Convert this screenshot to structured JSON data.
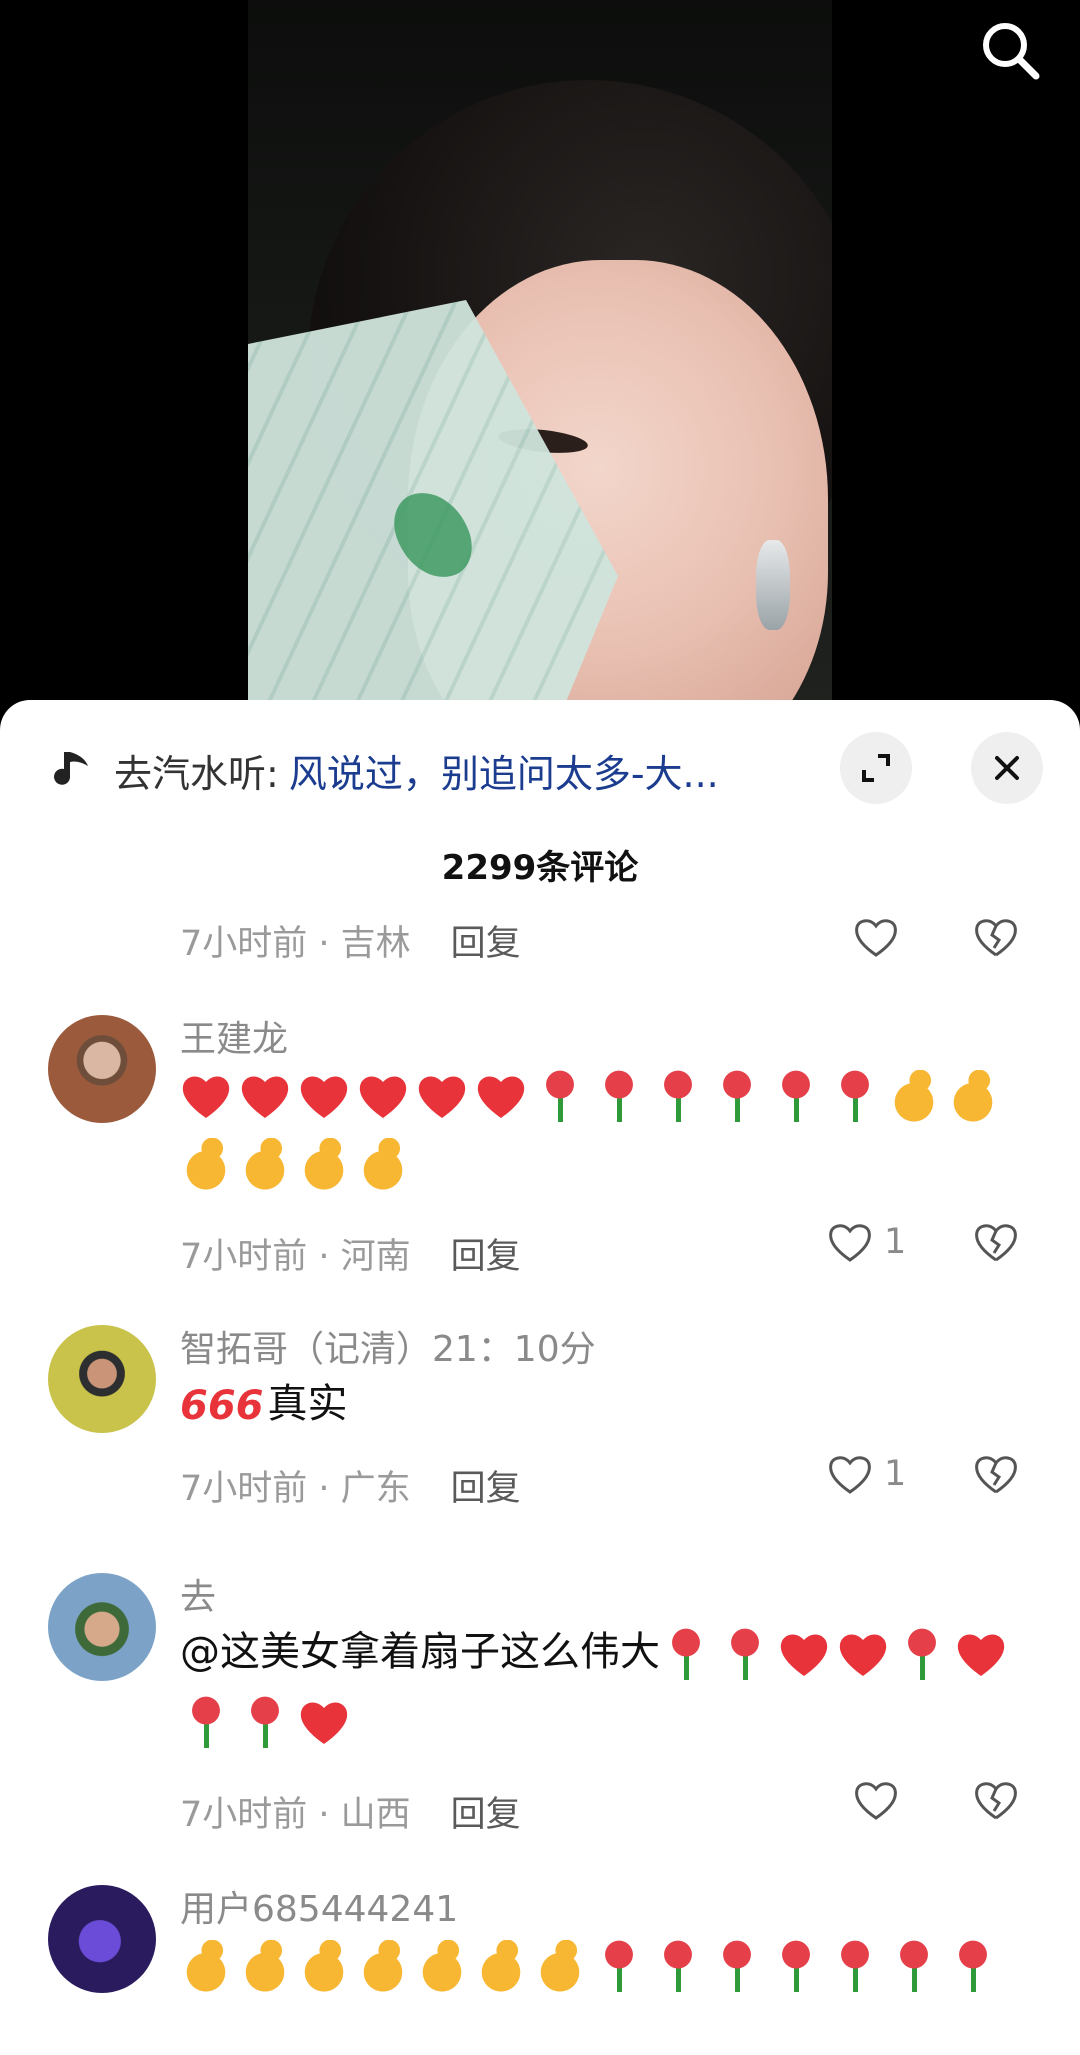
{
  "music": {
    "prefix": "去汽水听: ",
    "title": "风说过，别追问太多-大..."
  },
  "comment_count": "2299条评论",
  "partial_meta": {
    "time_loc": "7小时前 · 吉林",
    "reply": "回复"
  },
  "comments": [
    {
      "user": "王建龙",
      "emojis": [
        "heart",
        "heart",
        "heart",
        "heart",
        "heart",
        "heart",
        "rose",
        "rose",
        "rose",
        "rose",
        "rose",
        "rose",
        "thumb",
        "thumb",
        "thumb",
        "thumb",
        "thumb",
        "thumb"
      ],
      "time_loc": "7小时前 · 河南",
      "reply": "回复",
      "likes": "1"
    },
    {
      "user": "智拓哥（记清）21：10分",
      "prefix_glyph": "666",
      "text": "真实",
      "time_loc": "7小时前 · 广东",
      "reply": "回复",
      "likes": "1"
    },
    {
      "user": "去",
      "text": "@这美女拿着扇子这么伟大",
      "emojis": [
        "rose",
        "rose",
        "heart",
        "heart",
        "rose",
        "heart",
        "rose",
        "rose",
        "heart"
      ],
      "time_loc": "7小时前 · 山西",
      "reply": "回复"
    },
    {
      "user": "用户685444241",
      "emojis": [
        "thumb",
        "thumb",
        "thumb",
        "thumb",
        "thumb",
        "thumb",
        "thumb",
        "rose",
        "rose",
        "rose",
        "rose",
        "rose",
        "rose",
        "rose"
      ]
    }
  ],
  "colors": {
    "accent_link": "#1c3d8f",
    "heart": "#e8333a",
    "muted": "#8a8a8a"
  },
  "icons": [
    "search-icon",
    "music-note-icon",
    "expand-icon",
    "close-icon",
    "heart-outline-icon",
    "broken-heart-icon",
    "heart-emoji",
    "rose-emoji",
    "thumbs-up-emoji"
  ]
}
